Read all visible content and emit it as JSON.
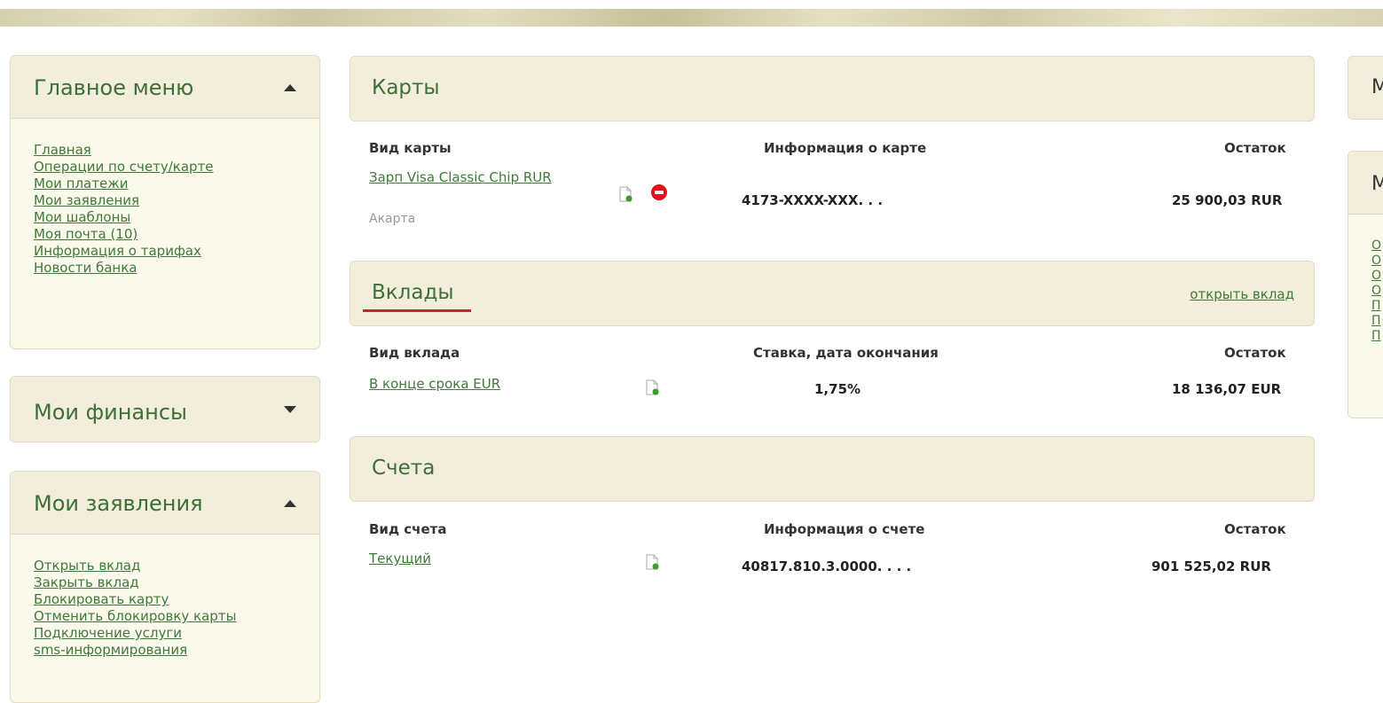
{
  "sidebar": {
    "main_menu": {
      "title": "Главное меню",
      "items": [
        "Главная",
        "Операции по счету/карте",
        "Мои платежи",
        "Мои заявления",
        "Мои шаблоны",
        "Моя почта (10)",
        "Информация о тарифах",
        "Новости банка"
      ]
    },
    "finances": {
      "title": "Мои финансы"
    },
    "applications": {
      "title": "Мои заявления",
      "items": [
        "Открыть вклад",
        "Закрыть вклад",
        "Блокировать карту",
        "Отменить блокировку карты",
        "Подключение услуги",
        "sms-информирования"
      ]
    }
  },
  "cards": {
    "title": "Карты",
    "columns": [
      "Вид карты",
      "Информация о карте",
      "Остаток"
    ],
    "rows": [
      {
        "name": "Зарп Visa Classic Chip RUR",
        "sub": "Акарта",
        "info": "4173-XXXX-XXX. . .",
        "balance": "25 900,03 RUR"
      }
    ]
  },
  "deposits": {
    "title": "Вклады",
    "open_link": "открыть вклад",
    "columns": [
      "Вид вклада",
      "Ставка, дата окончания",
      "Остаток"
    ],
    "rows": [
      {
        "name": "В конце срока EUR",
        "info": "1,75%",
        "balance": "18 136,07 EUR"
      }
    ]
  },
  "accounts": {
    "title": "Счета",
    "columns": [
      "Вид счета",
      "Информация о счете",
      "Остаток"
    ],
    "rows": [
      {
        "name": "Текущий",
        "info": "40817.810.3.0000. . . .",
        "balance": "901 525,02 RUR"
      }
    ]
  },
  "right_column": {
    "panel1_letter": "М",
    "panel2_letter": "М",
    "links": [
      "О",
      "О",
      "О",
      "О",
      "П",
      "П",
      "П"
    ]
  },
  "colors": {
    "accent_green": "#3d6f3a",
    "link_green": "#3f7a3a",
    "panel_bg": "#f3eedb",
    "red_marker": "#d8202a"
  }
}
